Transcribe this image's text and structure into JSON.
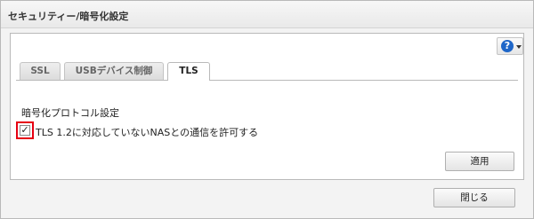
{
  "dialog": {
    "title": "セキュリティー/暗号化設定",
    "close_label": "閉じる"
  },
  "help": {
    "glyph": "?",
    "icon": "help-icon",
    "color": "#1e66c8"
  },
  "tabs": [
    {
      "label": "SSL",
      "active": false
    },
    {
      "label": "USBデバイス制御",
      "active": false
    },
    {
      "label": "TLS",
      "active": true
    }
  ],
  "tls": {
    "section_label": "暗号化プロトコル設定",
    "checkbox_label": "TLS 1.2に対応していないNASとの通信を許可する",
    "checkbox_checked": true,
    "checkbox_mark": "✓",
    "highlight_color": "#e60012",
    "apply_label": "適用"
  }
}
